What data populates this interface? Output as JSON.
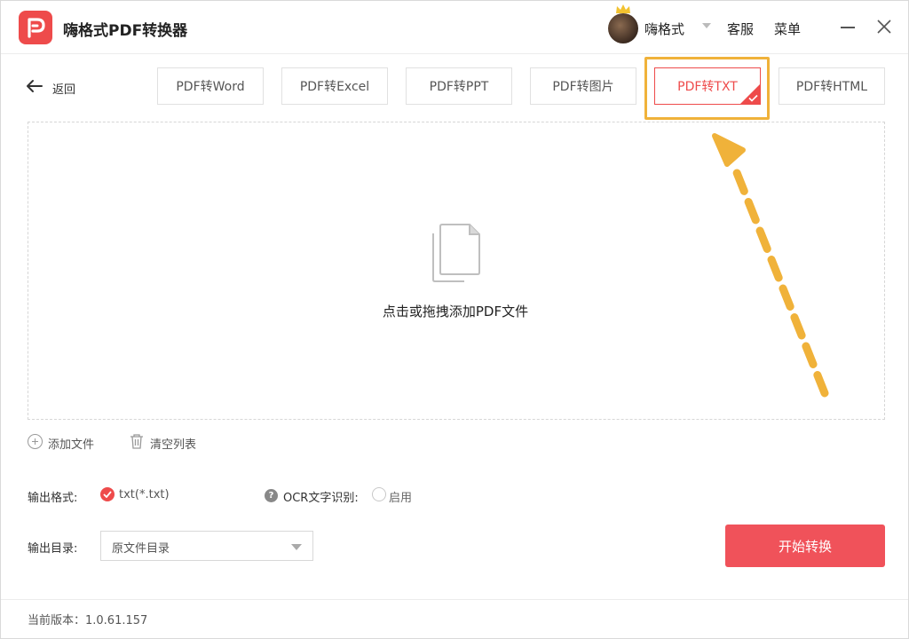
{
  "app": {
    "title": "嗨格式PDF转换器"
  },
  "header": {
    "username": "嗨格式",
    "service": "客服",
    "menu": "菜单"
  },
  "nav": {
    "back_label": "返回"
  },
  "tabs": [
    {
      "label": "PDF转Word"
    },
    {
      "label": "PDF转Excel"
    },
    {
      "label": "PDF转PPT"
    },
    {
      "label": "PDF转图片"
    },
    {
      "label": "PDF转TXT",
      "active": true
    },
    {
      "label": "PDF转HTML"
    }
  ],
  "dropzone": {
    "text": "点击或拖拽添加PDF文件"
  },
  "actions": {
    "add_file": "添加文件",
    "clear_list": "清空列表"
  },
  "output": {
    "format_label": "输出格式:",
    "format_value": "txt(*.txt)",
    "ocr_label": "OCR文字识别:",
    "ocr_enable": "启用",
    "dir_label": "输出目录:",
    "dir_value": "原文件目录",
    "start_button": "开始转换"
  },
  "footer": {
    "version": "当前版本：1.0.61.157"
  },
  "colors": {
    "accent": "#ee4b4b",
    "annotation": "#f0b23a"
  },
  "icons": {
    "logo": "app-logo-icon",
    "back": "arrow-left-icon",
    "file": "document-icon",
    "add": "plus-circle-icon",
    "clear": "trash-icon",
    "help": "question-icon",
    "close": "close-icon",
    "minimize": "minimize-icon"
  }
}
